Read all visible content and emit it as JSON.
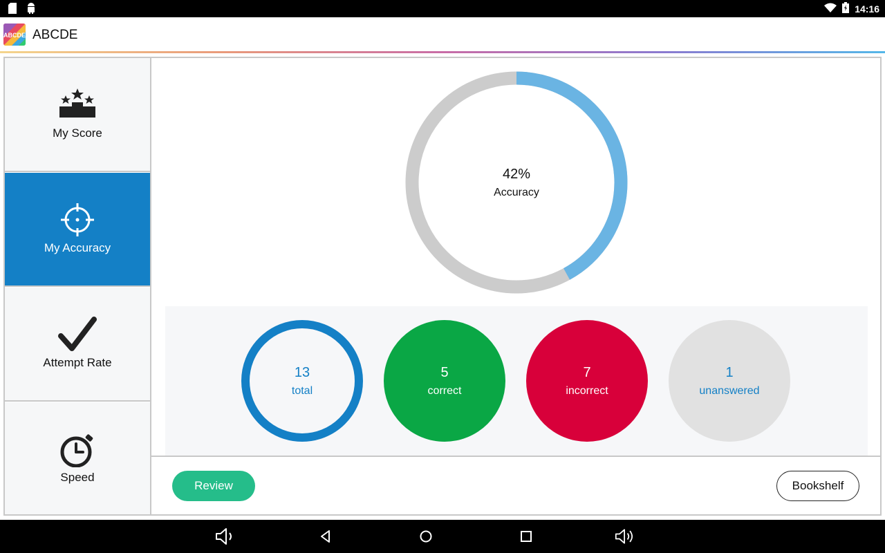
{
  "status_bar": {
    "time": "14:16",
    "icons": [
      "sd-card-icon",
      "android-icon",
      "wifi-icon",
      "battery-icon"
    ]
  },
  "app_bar": {
    "logo_text": "ABCDE",
    "title": "ABCDE"
  },
  "sidebar": {
    "items": [
      {
        "label": "My Score",
        "icon": "podium-stars-icon",
        "active": false
      },
      {
        "label": "My Accuracy",
        "icon": "crosshair-icon",
        "active": true
      },
      {
        "label": "Attempt Rate",
        "icon": "checkmark-icon",
        "active": false
      },
      {
        "label": "Speed",
        "icon": "stopwatch-icon",
        "active": false
      }
    ]
  },
  "accuracy": {
    "percent_text": "42%",
    "label": "Accuracy",
    "value": 0.42,
    "fill_color": "#6ab4e3",
    "track_color": "#cccccc"
  },
  "stats": {
    "total": {
      "value": "13",
      "label": "total"
    },
    "correct": {
      "value": "5",
      "label": "correct"
    },
    "incorrect": {
      "value": "7",
      "label": "incorrect"
    },
    "unanswered": {
      "value": "1",
      "label": "unanswered"
    }
  },
  "buttons": {
    "review": "Review",
    "bookshelf": "Bookshelf"
  },
  "colors": {
    "primary": "#1480c6",
    "correct": "#0aa745",
    "incorrect": "#d8003a",
    "unanswered": "#e1e1e1",
    "review_button": "#25bd8a"
  },
  "nav_bar": {
    "icons": [
      "volume-down-icon",
      "back-icon",
      "home-icon",
      "recents-icon",
      "volume-up-icon"
    ]
  }
}
